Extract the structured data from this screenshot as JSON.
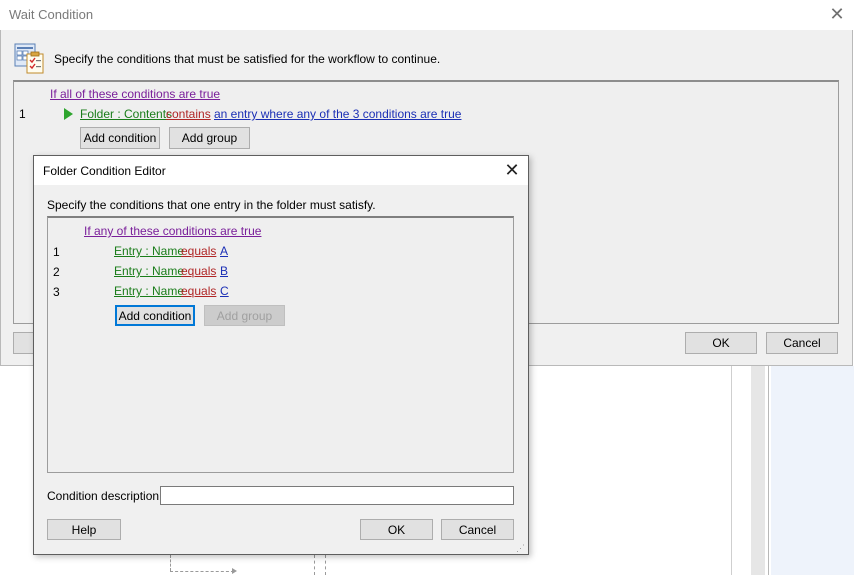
{
  "wait_condition": {
    "title": "Wait Condition",
    "header_text": "Specify the conditions that must be satisfied for the workflow to continue.",
    "root_group": "If all of these conditions are true",
    "rows": [
      {
        "number": "1",
        "field": "Folder : Contents",
        "operator": "contains",
        "value": "an entry where any of the 3 conditions are true"
      }
    ],
    "add_condition_label": "Add condition",
    "add_group_label": "Add group",
    "ok_label": "OK",
    "cancel_label": "Cancel"
  },
  "folder_editor": {
    "title": "Folder Condition Editor",
    "description": "Specify the conditions that one entry in the folder must satisfy.",
    "root_group": "If any of these conditions are true",
    "rows": [
      {
        "number": "1",
        "field": "Entry : Name",
        "operator": "equals",
        "value": "A"
      },
      {
        "number": "2",
        "field": "Entry : Name",
        "operator": "equals",
        "value": "B"
      },
      {
        "number": "3",
        "field": "Entry : Name",
        "operator": "equals",
        "value": "C"
      }
    ],
    "add_condition_label": "Add condition",
    "add_group_label": "Add group",
    "condition_description_label": "Condition description:",
    "condition_description_value": "",
    "help_label": "Help",
    "ok_label": "OK",
    "cancel_label": "Cancel"
  },
  "colors": {
    "group_link": "#7a1f9a",
    "field_link": "#1a7d1a",
    "operator_link": "#b02525",
    "value_link": "#1b2fb5",
    "focus_blue": "#0078d7"
  },
  "icons": {
    "wait_condition_icon": "clipboard-checklist-icon",
    "row_expand_icon": "green-triangle-icon"
  }
}
